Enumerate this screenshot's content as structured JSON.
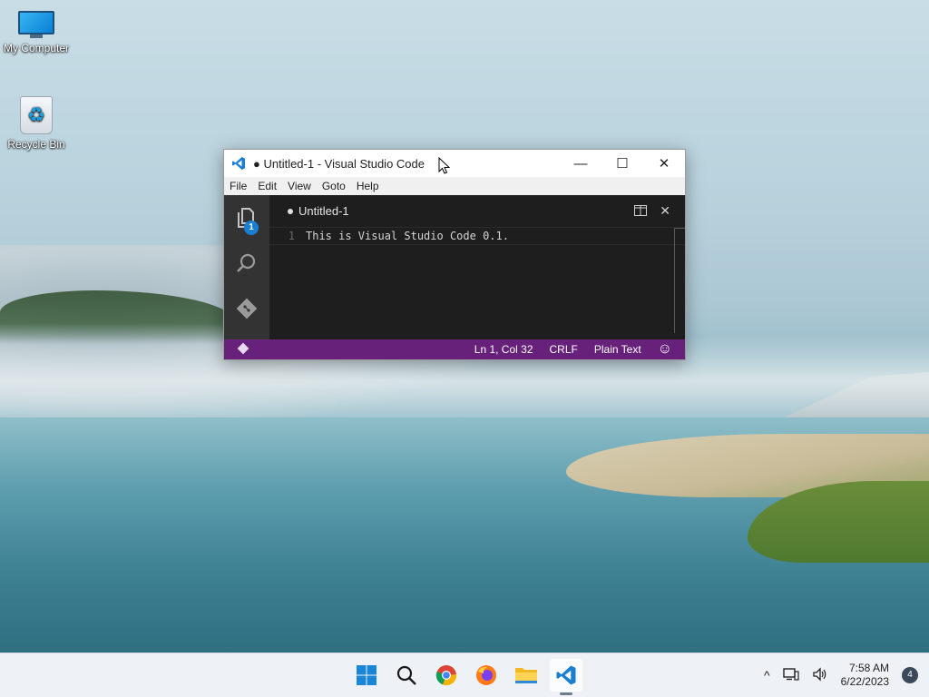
{
  "desktop": {
    "icons": [
      {
        "label": "My Computer"
      },
      {
        "label": "Recycle Bin"
      }
    ]
  },
  "window": {
    "title": "● Untitled-1 - Visual Studio Code",
    "controls": {
      "minimize": "—",
      "maximize": "☐",
      "close": "✕"
    },
    "menu": [
      "File",
      "Edit",
      "View",
      "Goto",
      "Help"
    ],
    "activity": {
      "explorer_badge": "1"
    },
    "tab": {
      "label": "Untitled-1"
    },
    "editor": {
      "line_number": "1",
      "line_text": "This is Visual Studio Code 0.1."
    },
    "status": {
      "position": "Ln 1, Col 32",
      "eol": "CRLF",
      "language": "Plain Text",
      "smiley": "☺"
    }
  },
  "taskbar": {
    "apps": [
      "start-icon",
      "search-icon",
      "chrome-icon",
      "firefox-icon",
      "file-explorer-icon",
      "vscode-icon"
    ],
    "tray": {
      "chevron": "^",
      "time": "7:58 AM",
      "date": "6/22/2023",
      "notifications": "4"
    }
  },
  "colors": {
    "status_bar": "#68217a",
    "editor_bg": "#1e1e1e",
    "activity_bar": "#333333",
    "vscode_blue": "#1a7fd4"
  }
}
